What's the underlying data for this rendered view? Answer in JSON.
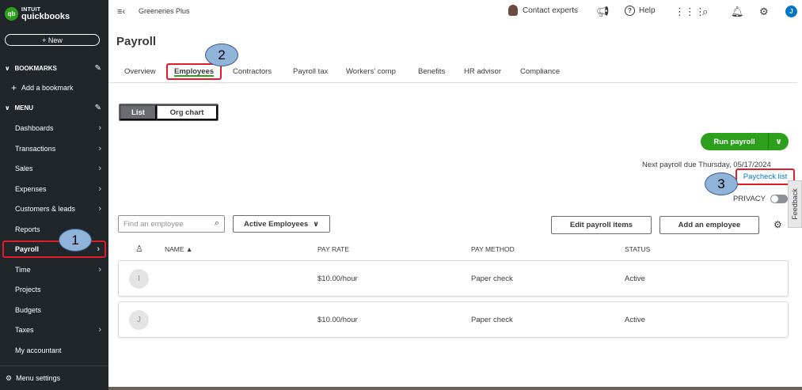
{
  "sidebar": {
    "logo_line1": "INTUIT",
    "logo_line2": "quickbooks",
    "logo_mark": "qb",
    "new_label": "+ New",
    "bookmarks_label": "BOOKMARKS",
    "add_bookmark_label": "Add a bookmark",
    "menu_label": "MENU",
    "items": [
      {
        "label": "Dashboards",
        "arrow": true
      },
      {
        "label": "Transactions",
        "arrow": true
      },
      {
        "label": "Sales",
        "arrow": true
      },
      {
        "label": "Expenses",
        "arrow": true
      },
      {
        "label": "Customers & leads",
        "arrow": true
      },
      {
        "label": "Reports",
        "arrow": false
      },
      {
        "label": "Payroll",
        "arrow": true,
        "active": true
      },
      {
        "label": "Time",
        "arrow": true
      },
      {
        "label": "Projects",
        "arrow": false
      },
      {
        "label": "Budgets",
        "arrow": false
      },
      {
        "label": "Taxes",
        "arrow": true
      },
      {
        "label": "My accountant",
        "arrow": false
      }
    ],
    "menu_settings_label": "Menu settings"
  },
  "topbar": {
    "company": "Greeneries Plus",
    "contact_label": "Contact experts",
    "help_label": "Help",
    "user_initial": "J",
    "icons": [
      "megaphone-icon",
      "help-icon",
      "apps-grid-icon",
      "search-icon",
      "bell-icon",
      "gear-icon"
    ]
  },
  "page": {
    "title": "Payroll",
    "tabs": [
      "Overview",
      "Employees",
      "Contractors",
      "Payroll tax",
      "Workers' comp",
      "Benefits",
      "HR advisor",
      "Compliance"
    ],
    "active_tab": "Employees"
  },
  "view_toggle": {
    "list": "List",
    "org": "Org chart"
  },
  "run_payroll": {
    "label": "Run payroll"
  },
  "next_payroll": "Next payroll due Thursday, 05/17/2024",
  "paycheck_list": "Paycheck list",
  "privacy_label": "PRIVACY",
  "feedback_label": "Feedback",
  "search": {
    "placeholder": "Find an employee"
  },
  "filter": {
    "selected": "Active Employees"
  },
  "actions": {
    "edit_payroll_items": "Edit payroll items",
    "add_employee": "Add an employee"
  },
  "table": {
    "columns": [
      "NAME ▲",
      "PAY RATE",
      "PAY METHOD",
      "STATUS"
    ],
    "rows": [
      {
        "initial": "I",
        "pay_rate": "$10.00/hour",
        "pay_method": "Paper check",
        "status": "Active"
      },
      {
        "initial": "J",
        "pay_rate": "$10.00/hour",
        "pay_method": "Paper check",
        "status": "Active"
      }
    ]
  },
  "annotations": [
    "1",
    "2",
    "3"
  ],
  "colors": {
    "brand_green": "#2ca01c",
    "sidebar_bg": "#21262a",
    "highlight_red": "#e11d2a",
    "link_blue": "#0077c5",
    "annotation_fill": "#90b3d9"
  }
}
